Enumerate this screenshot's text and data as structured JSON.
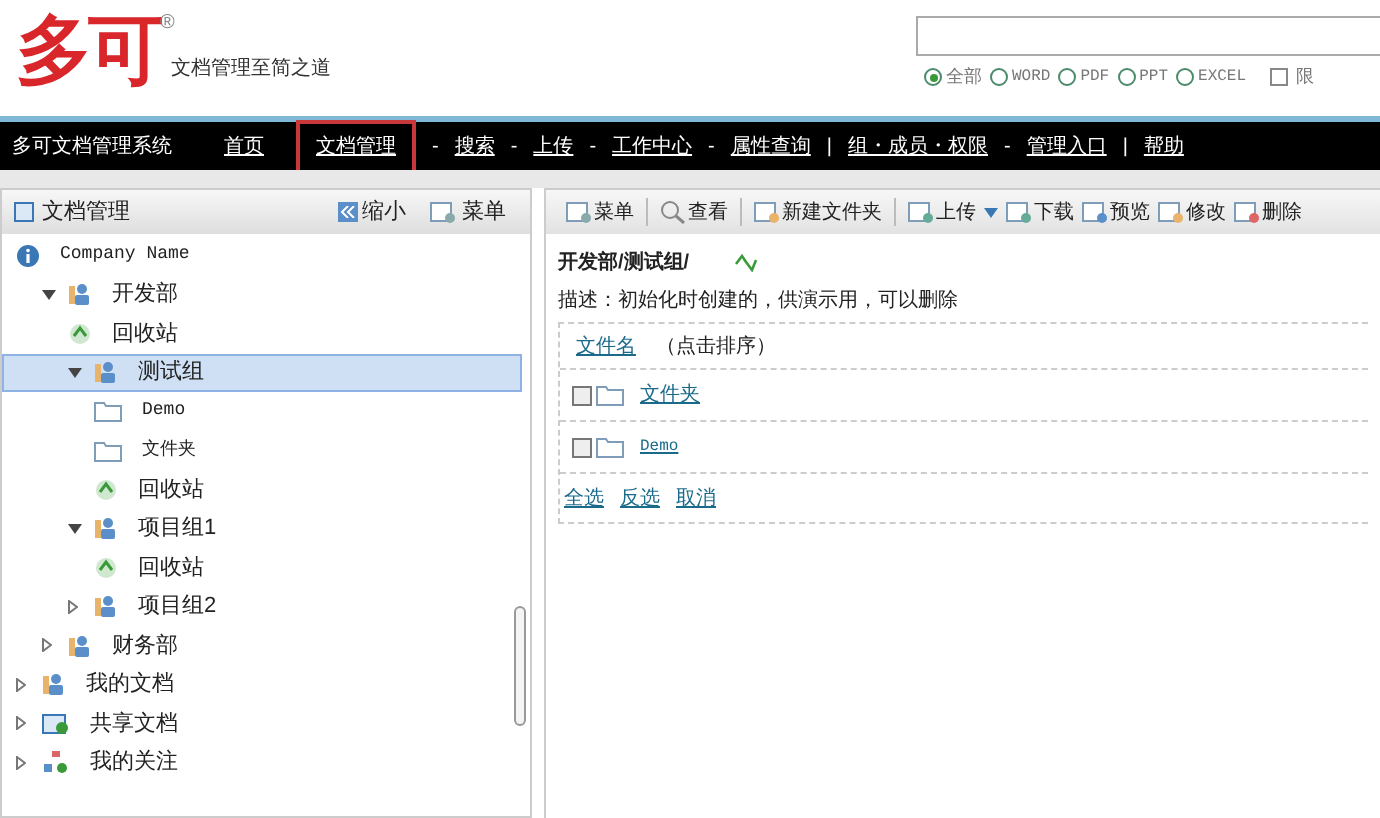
{
  "header": {
    "logo": "多可",
    "registered": "®",
    "slogan": "文档管理至简之道",
    "filters": [
      {
        "label": "全部",
        "selected": true
      },
      {
        "label": "WORD",
        "selected": false
      },
      {
        "label": "PDF",
        "selected": false
      },
      {
        "label": "PPT",
        "selected": false
      },
      {
        "label": "EXCEL",
        "selected": false
      }
    ],
    "limit": {
      "label": "限",
      "checked": false
    }
  },
  "nav": {
    "title": "多可文档管理系统",
    "items": [
      {
        "kind": "link",
        "label": "首页",
        "selected": false
      },
      {
        "kind": "link",
        "label": "文档管理",
        "selected": true
      },
      {
        "kind": "sep",
        "label": "-"
      },
      {
        "kind": "link",
        "label": "搜索",
        "selected": false
      },
      {
        "kind": "sep",
        "label": "-"
      },
      {
        "kind": "link",
        "label": "上传",
        "selected": false
      },
      {
        "kind": "sep",
        "label": "-"
      },
      {
        "kind": "link",
        "label": "工作中心",
        "selected": false
      },
      {
        "kind": "sep",
        "label": "-"
      },
      {
        "kind": "link",
        "label": "属性查询",
        "selected": false
      },
      {
        "kind": "sep",
        "label": "|"
      },
      {
        "kind": "link",
        "label": "组・成员・权限",
        "selected": false
      },
      {
        "kind": "sep",
        "label": "-"
      },
      {
        "kind": "link",
        "label": "管理入口",
        "selected": false
      },
      {
        "kind": "sep",
        "label": "|"
      },
      {
        "kind": "link",
        "label": "帮助",
        "selected": false
      }
    ]
  },
  "sidebar": {
    "title": "文档管理",
    "collapse": "缩小",
    "menu": "菜单",
    "tree": [
      {
        "kind": "company",
        "label": "Company Name",
        "selected": false,
        "children": [
          {
            "kind": "group",
            "label": "开发部",
            "expanded": true,
            "selected": false,
            "children": [
              {
                "kind": "recycle",
                "label": "回收站",
                "selected": false
              },
              {
                "kind": "group",
                "label": "测试组",
                "expanded": true,
                "selected": true,
                "children": [
                  {
                    "kind": "folder",
                    "label": "Demo",
                    "selected": false
                  },
                  {
                    "kind": "folder",
                    "label": "文件夹",
                    "selected": false
                  },
                  {
                    "kind": "recycle",
                    "label": "回收站",
                    "selected": false
                  }
                ]
              },
              {
                "kind": "group",
                "label": "项目组1",
                "expanded": true,
                "selected": false,
                "children": [
                  {
                    "kind": "recycle",
                    "label": "回收站",
                    "selected": false
                  }
                ]
              },
              {
                "kind": "group",
                "label": "项目组2",
                "expanded": false,
                "selected": false
              }
            ]
          },
          {
            "kind": "group",
            "label": "财务部",
            "expanded": false,
            "selected": false
          }
        ]
      },
      {
        "kind": "mydocs",
        "label": "我的文档",
        "expanded": false,
        "selected": false
      },
      {
        "kind": "shared",
        "label": "共享文档",
        "expanded": false,
        "selected": false
      },
      {
        "kind": "follow",
        "label": "我的关注",
        "expanded": false,
        "selected": false
      }
    ]
  },
  "toolbar": [
    [
      {
        "kind": "menu",
        "label": "菜单",
        "dropdown": false
      }
    ],
    [
      {
        "kind": "view",
        "label": "查看",
        "dropdown": false
      }
    ],
    [
      {
        "kind": "newfolder",
        "label": "新建文件夹",
        "dropdown": false
      }
    ],
    [
      {
        "kind": "upload",
        "label": "上传",
        "dropdown": true
      },
      {
        "kind": "download",
        "label": "下载",
        "dropdown": false
      },
      {
        "kind": "preview",
        "label": "预览",
        "dropdown": false
      },
      {
        "kind": "edit",
        "label": "修改",
        "dropdown": false
      },
      {
        "kind": "delete",
        "label": "删除",
        "dropdown": false
      }
    ]
  ],
  "content": {
    "path": "开发部/测试组/",
    "description": "描述：初始化时创建的，供演示用，可以删除",
    "column": "文件名",
    "sort_hint": "（点击排序）",
    "files": [
      {
        "label": "文件夹",
        "checked": false
      },
      {
        "label": "Demo",
        "checked": false
      }
    ],
    "actions": [
      "全选",
      "反选",
      "取消"
    ]
  }
}
